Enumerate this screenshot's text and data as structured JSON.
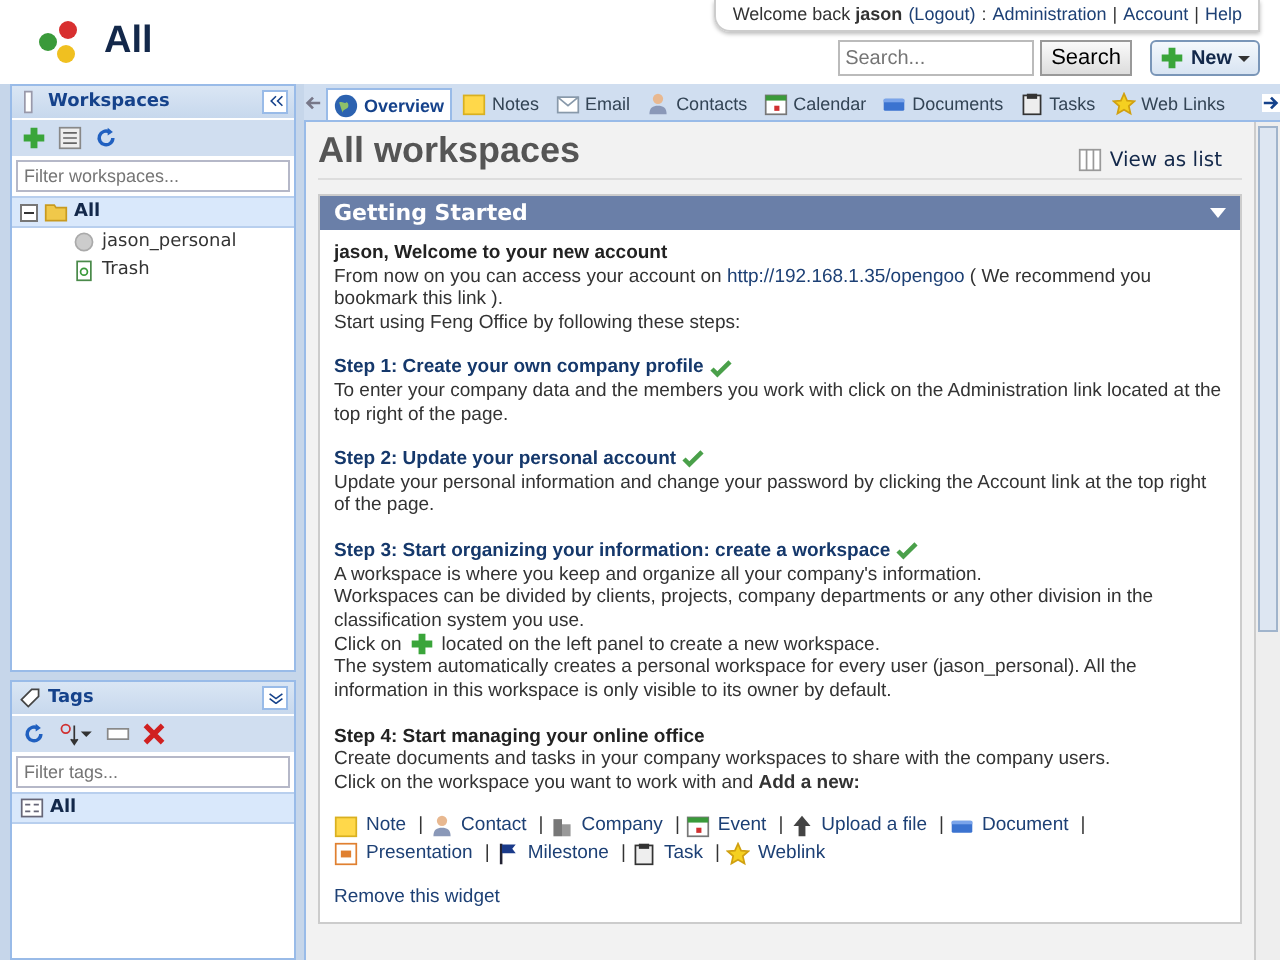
{
  "header": {
    "title": "All",
    "user_bar": {
      "welcome": "Welcome back",
      "username": "jason",
      "logout": "(Logout)",
      "colon": ":",
      "separator": "|",
      "links": [
        "Administration",
        "Account",
        "Help"
      ]
    },
    "search": {
      "placeholder": "Search...",
      "button": "Search"
    },
    "new_button": "New"
  },
  "workspaces": {
    "title": "Workspaces",
    "filter_placeholder": "Filter workspaces...",
    "tree": [
      {
        "label": "All",
        "kind": "folder",
        "expanded": true,
        "selected": true,
        "children": [
          {
            "label": "jason_personal",
            "kind": "workspace",
            "selected": false
          },
          {
            "label": "Trash",
            "kind": "trash",
            "selected": false
          }
        ]
      }
    ]
  },
  "tags": {
    "title": "Tags",
    "filter_placeholder": "Filter tags...",
    "items": [
      {
        "label": "All",
        "selected": true
      }
    ]
  },
  "tabs": [
    {
      "label": "Overview",
      "kind": "globe",
      "selected": true
    },
    {
      "label": "Notes",
      "kind": "note",
      "selected": false
    },
    {
      "label": "Email",
      "kind": "mail",
      "selected": false
    },
    {
      "label": "Contacts",
      "kind": "person",
      "selected": false
    },
    {
      "label": "Calendar",
      "kind": "calendar",
      "selected": false
    },
    {
      "label": "Documents",
      "kind": "documents",
      "selected": false
    },
    {
      "label": "Tasks",
      "kind": "tasks",
      "selected": false
    },
    {
      "label": "Web Links",
      "kind": "star",
      "selected": false
    }
  ],
  "page": {
    "title": "All workspaces",
    "view_as_list": "View as list"
  },
  "widget": {
    "title": "Getting Started",
    "greeting": "jason, Welcome to your new account",
    "intro_before": "From now on you can access your account on",
    "url": "http://192.168.1.35/opengoo",
    "intro_after": "( We recommend you bookmark this link ).",
    "intro_line": "Start using Feng Office by following these steps:",
    "steps": [
      {
        "title": "Step 1: Create your own company profile",
        "done": true,
        "paragraphs": [
          {
            "kind": "text",
            "text": "To enter your company data and the members you work with click on the Administration link located at the top right of the page."
          }
        ]
      },
      {
        "title": "Step 2: Update your personal account",
        "done": true,
        "paragraphs": [
          {
            "kind": "text",
            "text": "Update your personal information and change your password by clicking the Account link at the top right of the page."
          }
        ]
      },
      {
        "title": "Step 3: Start organizing your information: create a workspace",
        "done": true,
        "paragraphs": [
          {
            "kind": "text",
            "text": "A workspace is where you keep and organize all your company's information."
          },
          {
            "kind": "text",
            "text": "Workspaces can be divided by clients, projects, company departments or any other division in the classification system you use."
          },
          {
            "kind": "icon_text",
            "before": "Click on",
            "after": "located on the left panel to create a new workspace."
          },
          {
            "kind": "text",
            "text": "The system automatically creates a personal workspace for every user (jason_personal). All the information in this workspace is only visible to its owner by default."
          }
        ]
      },
      {
        "title": "Step 4: Start managing your online office",
        "done": false,
        "paragraphs": [
          {
            "kind": "text",
            "text": "Create documents and tasks in your company workspaces to share with the company users."
          },
          {
            "kind": "text",
            "text": "Click on the workspace you want to work with and **Add a new:**"
          }
        ]
      }
    ],
    "add_links": [
      {
        "label": "Note",
        "kind": "note"
      },
      {
        "label": "Contact",
        "kind": "person"
      },
      {
        "label": "Company",
        "kind": "company"
      },
      {
        "label": "Event",
        "kind": "calendar"
      },
      {
        "label": "Upload a file",
        "kind": "upload"
      },
      {
        "label": "Document",
        "kind": "documents"
      },
      {
        "label": "Presentation",
        "kind": "presentation"
      },
      {
        "label": "Milestone",
        "kind": "flag"
      },
      {
        "label": "Task",
        "kind": "tasks"
      },
      {
        "label": "Weblink",
        "kind": "star"
      }
    ],
    "separator": "|",
    "remove": "Remove this widget"
  }
}
